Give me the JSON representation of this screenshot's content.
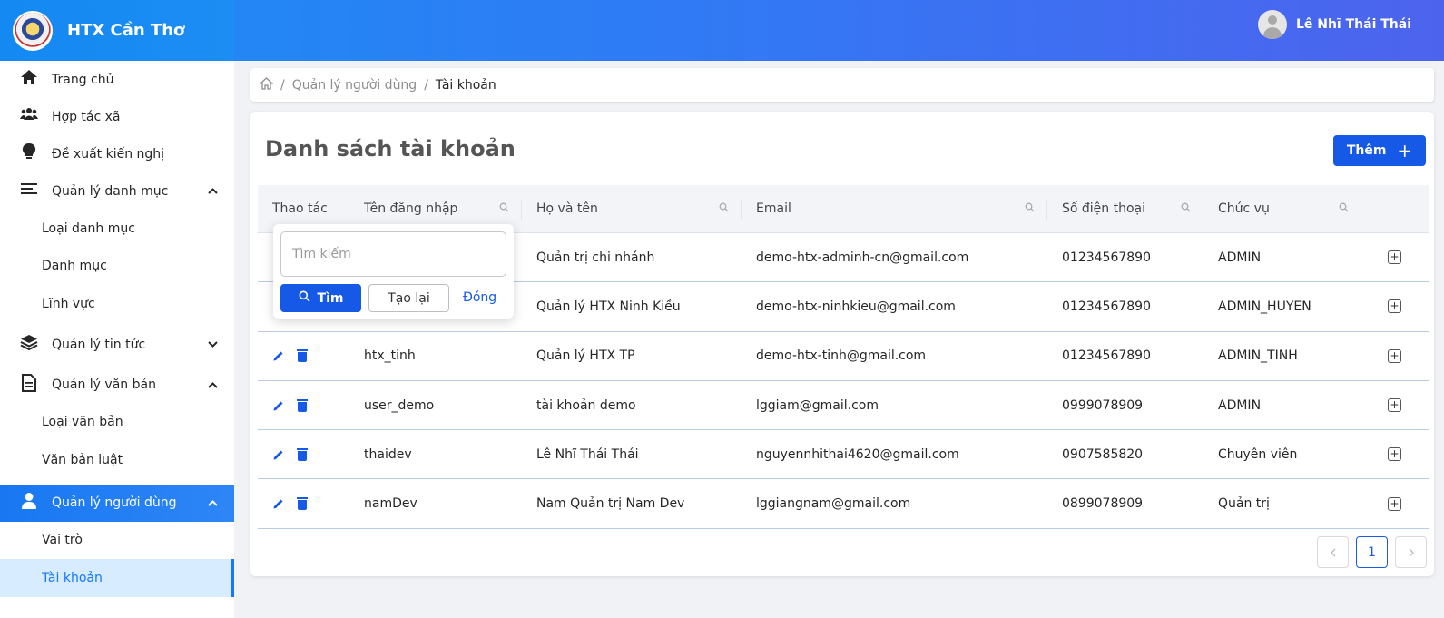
{
  "app": {
    "brand_name": "HTX Cần Thơ"
  },
  "user": {
    "name": "Lê Nhĩ Thái Thái"
  },
  "sidebar": {
    "items": [
      {
        "label": "Trang chủ",
        "icon": "home-icon"
      },
      {
        "label": "Hợp tác xã",
        "icon": "users-icon"
      },
      {
        "label": "Đề xuất kiến nghị",
        "icon": "lightbulb-icon"
      },
      {
        "label": "Quản lý danh mục",
        "icon": "menu-icon",
        "expanded": true
      },
      {
        "label": "Loại danh mục"
      },
      {
        "label": "Danh mục"
      },
      {
        "label": "Lĩnh vực"
      },
      {
        "label": "Quản lý tin tức",
        "icon": "layers-icon",
        "expanded": false
      },
      {
        "label": "Quản lý văn bản",
        "icon": "document-icon",
        "expanded": true
      },
      {
        "label": "Loại văn bản"
      },
      {
        "label": "Văn bản luật"
      },
      {
        "label": "Quản lý người dùng",
        "icon": "user-icon",
        "expanded": true
      },
      {
        "label": "Vai trò"
      },
      {
        "label": "Tài khoản"
      }
    ]
  },
  "breadcrumb": {
    "parent": "Quản lý người dùng",
    "current": "Tài khoản"
  },
  "page": {
    "title": "Danh sách tài khoản",
    "add_label": "Thêm"
  },
  "table": {
    "headers": [
      "Thao tác",
      "Tên đăng nhập",
      "Họ và tên",
      "Email",
      "Số điện thoại",
      "Chức vụ"
    ],
    "rows": [
      {
        "username": "",
        "fullname": "Quản trị chi nhánh",
        "email": "demo-htx-adminh-cn@gmail.com",
        "phone": "01234567890",
        "role": "ADMIN"
      },
      {
        "username": "",
        "fullname": "Quản lý HTX Ninh Kiều",
        "email": "demo-htx-ninhkieu@gmail.com",
        "phone": "01234567890",
        "role": "ADMIN_HUYEN"
      },
      {
        "username": "htx_tinh",
        "fullname": "Quản lý HTX TP",
        "email": "demo-htx-tinh@gmail.com",
        "phone": "01234567890",
        "role": "ADMIN_TINH"
      },
      {
        "username": "user_demo",
        "fullname": "tài khoản demo",
        "email": "lggiam@gmail.com",
        "phone": "0999078909",
        "role": "ADMIN"
      },
      {
        "username": "thaidev",
        "fullname": "Lê Nhĩ Thái Thái",
        "email": "nguyennhithai4620@gmail.com",
        "phone": "0907585820",
        "role": "Chuyên viên"
      },
      {
        "username": "namDev",
        "fullname": "Nam Quản trị Nam Dev",
        "email": "lggiangnam@gmail.com",
        "phone": "0899078909",
        "role": "Quản trị"
      }
    ]
  },
  "search_popover": {
    "placeholder": "Tìm kiếm",
    "search_label": "Tìm",
    "reset_label": "Tạo lại",
    "close_label": "Đóng"
  },
  "pagination": {
    "current_page": "1"
  },
  "colors": {
    "primary": "#1659e6",
    "header_start": "#1c8df3",
    "header_end": "#4d63ee",
    "active_item_bg": "#d7ecff"
  }
}
